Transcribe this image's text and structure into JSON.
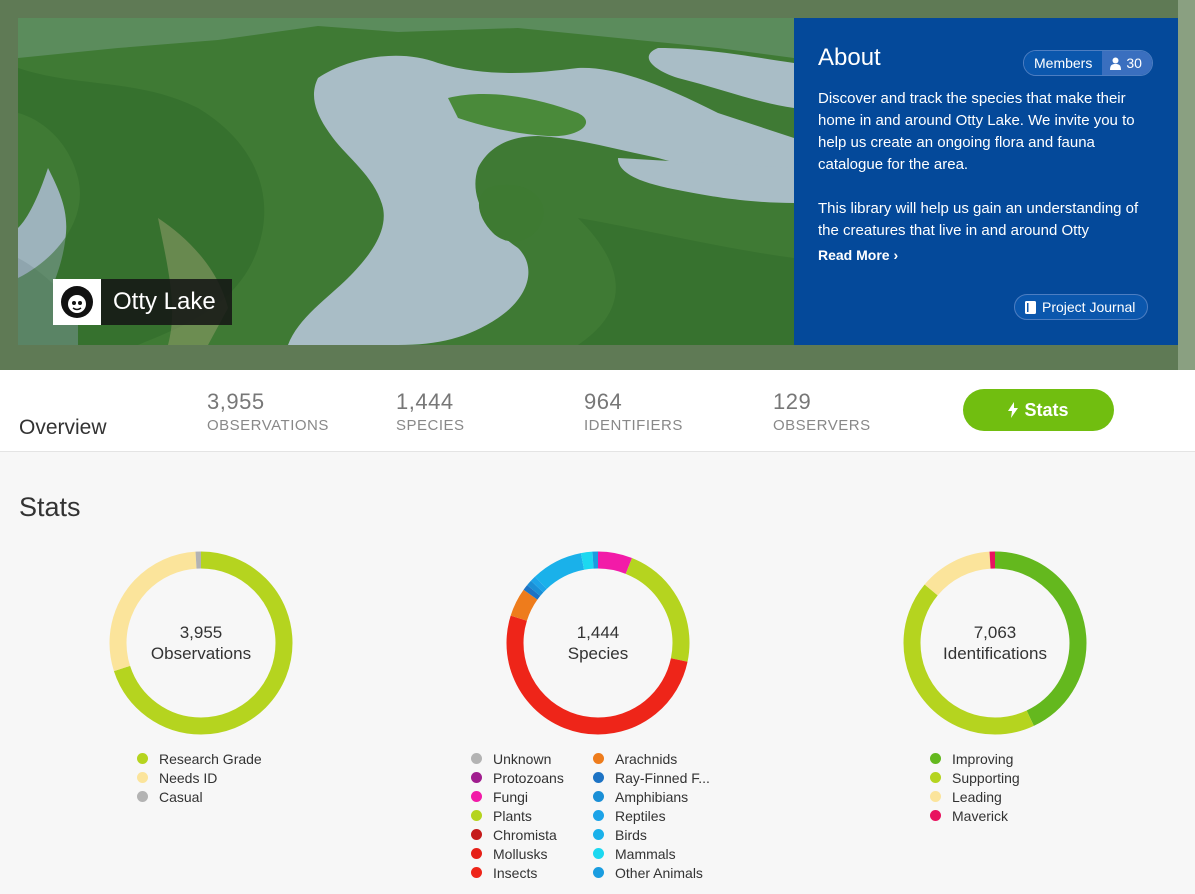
{
  "project": {
    "name": "Otty Lake"
  },
  "about": {
    "title": "About",
    "members_label": "Members",
    "members_count": "30",
    "paragraph1": "Discover and track the species that make their home in and around Otty Lake. We invite you to help us create an ongoing flora and fauna catalogue for the area.",
    "paragraph2": "This library will help us gain an understanding of the creatures that live in and around Otty",
    "read_more": "Read More",
    "journal_label": "Project Journal"
  },
  "overview": {
    "label": "Overview",
    "stats": [
      {
        "value": "3,955",
        "label": "OBSERVATIONS"
      },
      {
        "value": "1,444",
        "label": "SPECIES"
      },
      {
        "value": "964",
        "label": "IDENTIFIERS"
      },
      {
        "value": "129",
        "label": "OBSERVERS"
      }
    ],
    "stats_button": "Stats"
  },
  "stats": {
    "heading": "Stats",
    "charts": [
      {
        "total": "3,955",
        "caption": "Observations",
        "segments": [
          {
            "label": "Research Grade",
            "value": 70,
            "color": "#b5d41f"
          },
          {
            "label": "Needs ID",
            "value": 29,
            "color": "#fbe49b"
          },
          {
            "label": "Casual",
            "value": 1,
            "color": "#b3b3b3"
          }
        ]
      },
      {
        "total": "1,444",
        "caption": "Species",
        "segments": [
          {
            "label": "Unknown",
            "value": 0,
            "color": "#b3b3b3"
          },
          {
            "label": "Protozoans",
            "value": 0,
            "color": "#a01d8e"
          },
          {
            "label": "Fungi",
            "value": 6,
            "color": "#f21ba8"
          },
          {
            "label": "Plants",
            "value": 22,
            "color": "#b5d41f"
          },
          {
            "label": "Chromista",
            "value": 0,
            "color": "#c51a1a"
          },
          {
            "label": "Mollusks",
            "value": 0,
            "color": "#e62018"
          },
          {
            "label": "Insects",
            "value": 51,
            "color": "#ee2519"
          },
          {
            "label": "Arachnids",
            "value": 5,
            "color": "#ee7c1c"
          },
          {
            "label": "Ray-Finned F...",
            "value": 1,
            "color": "#1d73c4"
          },
          {
            "label": "Amphibians",
            "value": 1,
            "color": "#1a8fd6"
          },
          {
            "label": "Reptiles",
            "value": 1,
            "color": "#1ca3e8"
          },
          {
            "label": "Birds",
            "value": 9,
            "color": "#1ab1ea"
          },
          {
            "label": "Mammals",
            "value": 2,
            "color": "#1cd8f0"
          },
          {
            "label": "Other Animals",
            "value": 1,
            "color": "#1a9de0"
          }
        ]
      },
      {
        "total": "7,063",
        "caption": "Identifications",
        "segments": [
          {
            "label": "Improving",
            "value": 43,
            "color": "#64b81e"
          },
          {
            "label": "Supporting",
            "value": 43,
            "color": "#b5d41f"
          },
          {
            "label": "Leading",
            "value": 13,
            "color": "#fbe49b"
          },
          {
            "label": "Maverick",
            "value": 1,
            "color": "#e8135f"
          }
        ]
      }
    ]
  }
}
